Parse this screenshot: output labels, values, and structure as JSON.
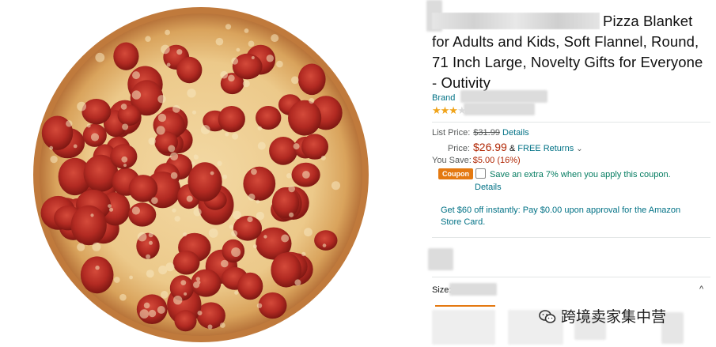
{
  "product": {
    "title": "Pizza Blanket for Adults and Kids, Soft Flannel, Round, 71 Inch Large, Novelty Gifts for Everyone - Outivity",
    "brand": "Brand",
    "rating_stars": "★★★",
    "rating_dim_stars": "★★"
  },
  "pricing": {
    "list_price_label": "List Price:",
    "list_price": "$31.99",
    "details_link": "Details",
    "price_label": "Price:",
    "price": "$26.99",
    "ampersand": "&",
    "free_returns": "FREE Returns",
    "returns_chevron": "⌄",
    "you_save_label": "You Save:",
    "you_save": "$5.00 (16%)"
  },
  "coupon": {
    "badge": "Coupon",
    "text": "Save an extra 7% when you apply this coupon.",
    "details_link": "Details"
  },
  "card_offer": "Get $60 off instantly: Pay $0.00 upon approval for the Amazon Store Card.",
  "size": {
    "label": "Size:",
    "chevron": "^"
  },
  "watermark": "跨境卖家集中营",
  "colors": {
    "link": "#007185",
    "price": "#b12704",
    "coupon_badge": "#e47911",
    "coupon_text": "#067d62",
    "star": "#f0a41b"
  }
}
